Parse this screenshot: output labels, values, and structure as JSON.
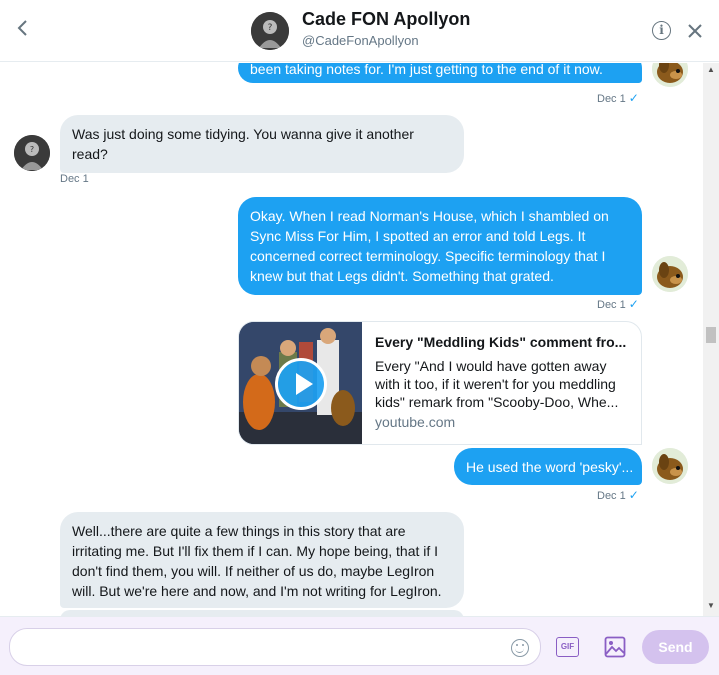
{
  "header": {
    "name": "Cade FON Apollyon",
    "handle": "@CadeFonApollyon"
  },
  "messages": [
    {
      "sender": "me",
      "text": "been taking notes for. I'm just getting to the end of it now.",
      "time": "Dec 1"
    },
    {
      "sender": "them",
      "text": "Was just doing some tidying. You wanna give it another read?",
      "time": "Dec 1"
    },
    {
      "sender": "me",
      "text": "Okay. When I read Norman's House, which I shambled on Sync Miss For Him, I spotted an error and told Legs. It concerned correct terminology. Specific terminology that I knew but that Legs didn't. Something that grated.",
      "time": "Dec 1"
    },
    {
      "sender": "me",
      "text": "He used the word 'pesky'...",
      "time": "Dec 1"
    },
    {
      "sender": "them",
      "text": "Well...there are quite a few things in this story that are irritating me. But I'll fix them if I can. My hope being, that if I don't find them, you will. If neither of us do, maybe LegIron will. But we're here and now, and I'm not writing for LegIron."
    }
  ],
  "link_card": {
    "title": "Every \"Meddling Kids\" comment fro...",
    "description": "Every \"And I would have gotten away with it too, if it weren't for you meddling kids\" remark from \"Scooby-Doo, Whe...",
    "domain": "youtube.com"
  },
  "composer": {
    "placeholder": "",
    "gif_label": "GIF",
    "send_label": "Send"
  },
  "icons": {
    "back": "chevron-left-icon",
    "info": "info-icon",
    "close": "close-icon",
    "emoji": "emoji-icon",
    "gif": "gif-icon",
    "image": "image-icon"
  },
  "colors": {
    "sent_bubble": "#1da1f2",
    "received_bubble": "#e6ecf0",
    "send_button": "#d4c2ee",
    "accent_purple": "#8a5ec4"
  }
}
